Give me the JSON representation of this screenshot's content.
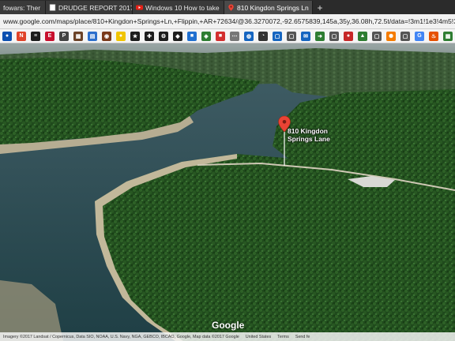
{
  "tabs": [
    {
      "label": "fowars: Ther",
      "active": false,
      "close": "×"
    },
    {
      "label": "DRUDGE REPORT 2017®",
      "active": false,
      "close": "×"
    },
    {
      "label": "Windows 10 How to take",
      "active": false,
      "close": "×"
    },
    {
      "label": "810 Kingdon Springs Ln",
      "active": true,
      "close": "×"
    }
  ],
  "new_tab": "+",
  "address_bar": {
    "url": "www.google.com/maps/place/810+Kingdon+Springs+Ln,+Flippin,+AR+72634/@36.3270072,-92.6575839,145a,35y,36.08h,72.5t/data=!3m1!1e3!4m5!3m4!1s0x87ce3b79f32686b"
  },
  "bookmarks": [
    {
      "icon": "cbs-icon",
      "color": "#0a4fb0",
      "glyph": "●"
    },
    {
      "icon": "nbc-icon",
      "color": "#e0442a",
      "glyph": "N"
    },
    {
      "icon": "news-icon",
      "color": "#1d1d1d",
      "glyph": "≡"
    },
    {
      "icon": "espn-icon",
      "color": "#c8102e",
      "glyph": "E"
    },
    {
      "icon": "p-icon",
      "color": "#444444",
      "glyph": "P"
    },
    {
      "icon": "tv-icon",
      "color": "#6b4226",
      "glyph": "▦"
    },
    {
      "icon": "doc-icon",
      "color": "#2c6fcc",
      "glyph": "▤"
    },
    {
      "icon": "circle-icon",
      "color": "#7a3a1a",
      "glyph": "◉"
    },
    {
      "icon": "sun-icon",
      "color": "#f0c400",
      "glyph": "●"
    },
    {
      "icon": "star-icon",
      "color": "#1d1d1d",
      "glyph": "★"
    },
    {
      "icon": "cross-icon",
      "color": "#1d1d1d",
      "glyph": "✚"
    },
    {
      "icon": "gear-icon",
      "color": "#1d1d1d",
      "glyph": "⚙"
    },
    {
      "icon": "badge-icon",
      "color": "#1d1d1d",
      "glyph": "◆"
    },
    {
      "icon": "blue-icon",
      "color": "#1f6fd0",
      "glyph": "■"
    },
    {
      "icon": "shield-icon",
      "color": "#2e7d32",
      "glyph": "◈"
    },
    {
      "icon": "red-icon",
      "color": "#d32f2f",
      "glyph": "■"
    },
    {
      "icon": "dots-icon",
      "color": "#777777",
      "glyph": "⋯"
    },
    {
      "icon": "globe-icon",
      "color": "#1565c0",
      "glyph": "◍"
    },
    {
      "icon": "gauge-icon",
      "color": "#333333",
      "glyph": "◔"
    },
    {
      "icon": "page-icon",
      "color": "#1565c0",
      "glyph": "▢"
    },
    {
      "icon": "file-icon",
      "color": "#555555",
      "glyph": "▢"
    },
    {
      "icon": "mail-icon",
      "color": "#1565c0",
      "glyph": "✉"
    },
    {
      "icon": "arrow-icon",
      "color": "#2e7d32",
      "glyph": "➜"
    },
    {
      "icon": "page2-icon",
      "color": "#555555",
      "glyph": "▢"
    },
    {
      "icon": "red2-icon",
      "color": "#c62828",
      "glyph": "●"
    },
    {
      "icon": "green-icon",
      "color": "#2e7d32",
      "glyph": "▲"
    },
    {
      "icon": "page3-icon",
      "color": "#555555",
      "glyph": "▢"
    },
    {
      "icon": "wheel-icon",
      "color": "#f57c00",
      "glyph": "✺"
    },
    {
      "icon": "page4-icon",
      "color": "#555555",
      "glyph": "▢"
    },
    {
      "icon": "g-icon",
      "color": "#4285f4",
      "glyph": "G"
    },
    {
      "icon": "fire-icon",
      "color": "#e65100",
      "glyph": "♨"
    },
    {
      "icon": "grid-icon",
      "color": "#2e7d32",
      "glyph": "▦"
    },
    {
      "icon": "red3-icon",
      "color": "#b71c1c",
      "glyph": "■"
    },
    {
      "icon": "k-icon",
      "color": "#333333",
      "glyph": "K"
    },
    {
      "icon": "extra-icon",
      "color": "#6a1b9a",
      "glyph": "◧"
    }
  ],
  "map": {
    "pin_label": "810 Kingdon\nSprings Lane",
    "pin_color": "#ea4335",
    "google_logo": "Google",
    "attribution": {
      "imagery": "Imagery ©2017 Landsat / Copernicus, Data SIO, NOAA, U.S. Navy, NGA, GEBCO, IBCAO, Google, Map data ©2017 Google",
      "country": "United States",
      "terms": "Terms",
      "feedback": "Send fe"
    }
  }
}
